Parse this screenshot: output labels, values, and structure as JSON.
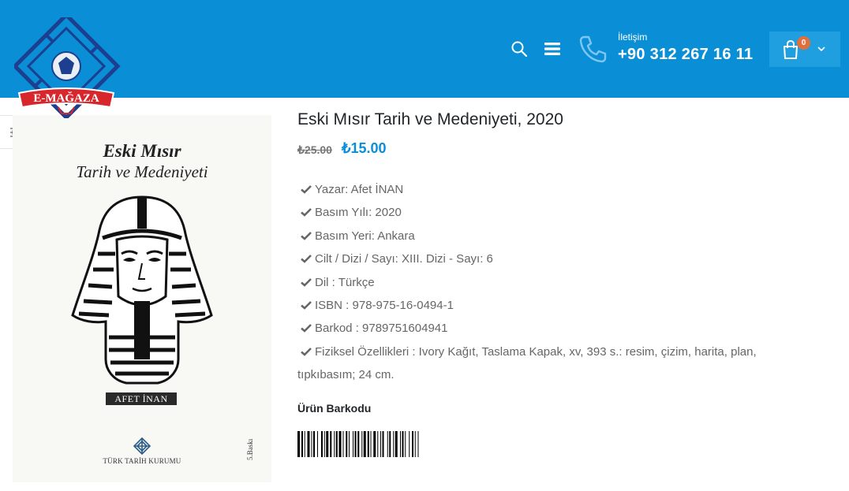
{
  "header": {
    "logo_text": "E-MAĞAZA",
    "contact_label": "İletişim",
    "contact_phone": "+90 312 267 16 11",
    "cart_count": "0",
    "background_color": "#0a8fd7",
    "cart_badge_color": "#e06f3b",
    "icons": [
      "search-icon",
      "menu-icon",
      "phone-icon",
      "cart-icon",
      "chevron-down-icon"
    ]
  },
  "sidebar": {
    "filter_icon": "sliders-icon"
  },
  "cover": {
    "title_line1": "Eski Mısır",
    "title_line2": "Tarih ve Medeniyeti",
    "author": "AFET İNAN",
    "publisher": "TÜRK TARİH KURUMU",
    "edition": "5.Baskı"
  },
  "product": {
    "title": "Eski Mısır Tarih ve Medeniyeti, 2020",
    "old_price": "₺25.00",
    "new_price": "₺15.00",
    "price_color": "#0a8fd7",
    "attributes": [
      "Yazar: Afet İNAN",
      "Basım Yılı: 2020",
      "Basım Yeri: Ankara",
      "Cilt / Dizi / Sayı: XIII. Dizi - Sayı: 6",
      "Dil : Türkçe",
      "ISBN : 978-975-16-0494-1",
      "Barkod : 9789751604941",
      "Fiziksel Özellikleri : Ivory Kağıt, Taslama Kapak, xv, 393 s.: resim, çizim, harita, plan, tıpkıbasım; 24 cm."
    ],
    "barcode_heading": "Ürün Barkodu"
  }
}
